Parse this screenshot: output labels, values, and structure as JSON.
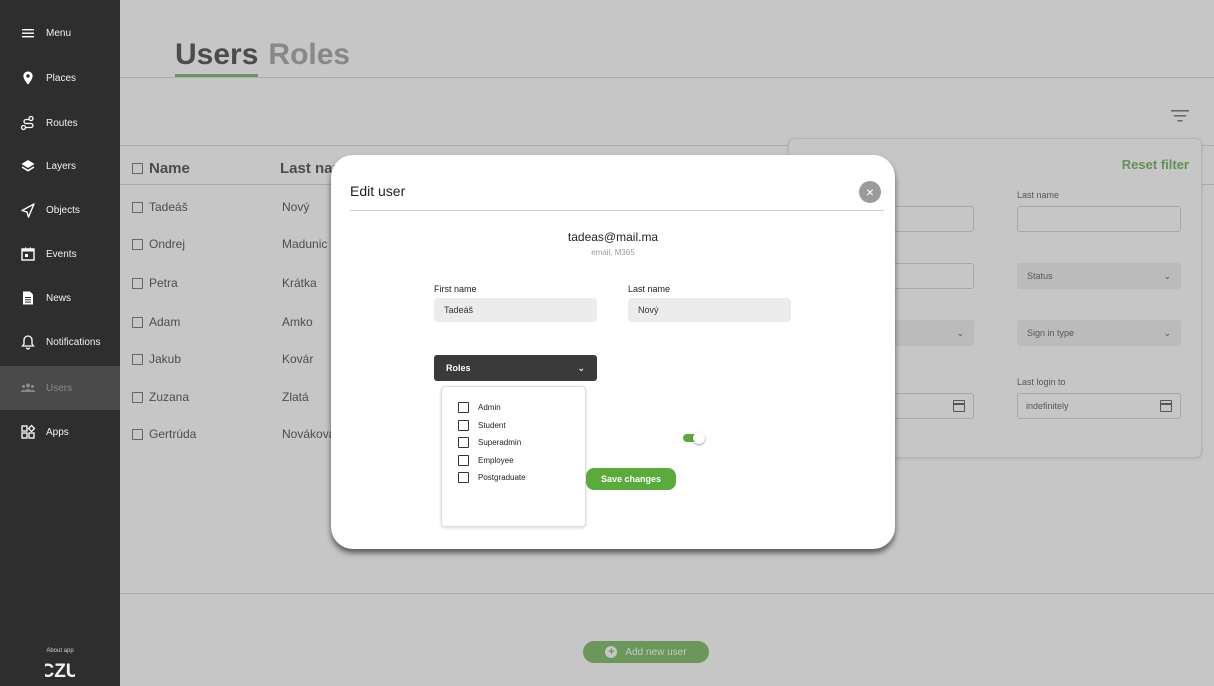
{
  "sidebar": {
    "items": [
      {
        "label": "Menu",
        "icon": "hamburger-icon"
      },
      {
        "label": "Places",
        "icon": "map-pin-icon"
      },
      {
        "label": "Routes",
        "icon": "route-icon"
      },
      {
        "label": "Layers",
        "icon": "layers-icon"
      },
      {
        "label": "Objects",
        "icon": "cursor-icon"
      },
      {
        "label": "Events",
        "icon": "calendar-icon"
      },
      {
        "label": "News",
        "icon": "document-icon"
      },
      {
        "label": "Notifications",
        "icon": "bell-icon"
      },
      {
        "label": "Users",
        "icon": "users-icon"
      },
      {
        "label": "Apps",
        "icon": "apps-icon"
      }
    ],
    "about": "About app",
    "logo_text": "CZU"
  },
  "tabs": {
    "users": "Users",
    "roles": "Roles"
  },
  "table": {
    "headers": {
      "name": "Name",
      "last_name": "Last nar"
    },
    "rows": [
      {
        "name": "Tadeáš",
        "last_name": "Nový"
      },
      {
        "name": "Ondrej",
        "last_name": "Madunic"
      },
      {
        "name": "Petra",
        "last_name": "Krátka"
      },
      {
        "name": "Adam",
        "last_name": "Amko"
      },
      {
        "name": "Jakub",
        "last_name": "Kovár"
      },
      {
        "name": "Zuzana",
        "last_name": "Zlatá"
      },
      {
        "name": "Gertrúda",
        "last_name": "Nováková"
      }
    ]
  },
  "filter": {
    "reset": "Reset filter",
    "last_name_label": "Last name",
    "status_placeholder": "Status",
    "sign_in_type_placeholder": "Sign in type",
    "last_login_to_label": "Last login to",
    "last_login_to_value": "indefinitely"
  },
  "add_user_button": "Add new user",
  "modal": {
    "title": "Edit user",
    "email": "tadeas@mail.ma",
    "email_sub": "email, M365",
    "first_name_label": "First name",
    "first_name_value": "Tadeáš",
    "last_name_label": "Last name",
    "last_name_value": "Nový",
    "roles_label": "Roles",
    "roles": [
      "Admin",
      "Student",
      "Superadmin",
      "Employee",
      "Postgraduate"
    ],
    "toggle_on": true,
    "save_label": "Save changes"
  },
  "colors": {
    "accent": "#5aaa3c",
    "sidebar_bg": "#2e2e2e",
    "dark_button": "#3a3a3a"
  }
}
